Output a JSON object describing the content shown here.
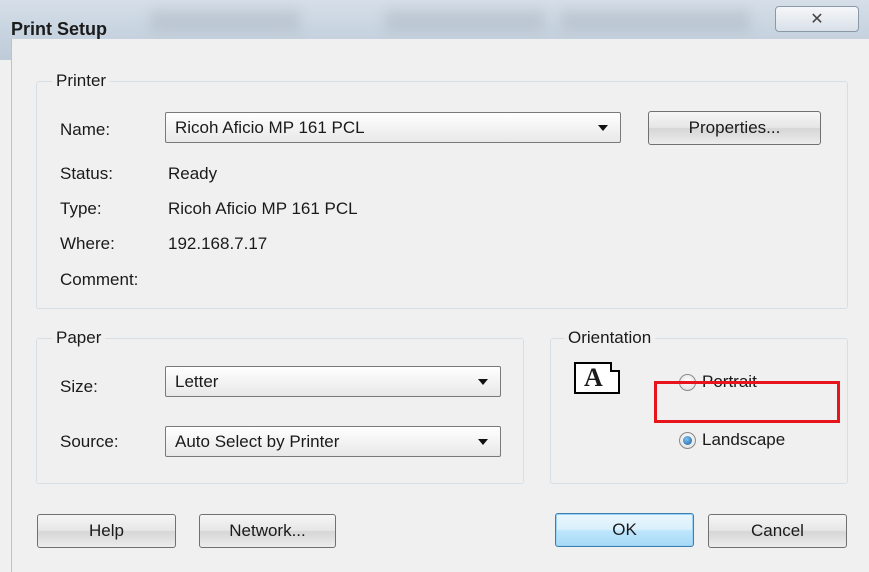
{
  "window": {
    "title": "Print Setup",
    "close_glyph": "✕"
  },
  "printer": {
    "legend": "Printer",
    "name_label": "Name:",
    "name_value": "Ricoh Aficio MP 161 PCL",
    "properties_label": "Properties...",
    "status_label": "Status:",
    "status_value": "Ready",
    "type_label": "Type:",
    "type_value": "Ricoh Aficio MP 161 PCL",
    "where_label": "Where:",
    "where_value": "192.168.7.17",
    "comment_label": "Comment:",
    "comment_value": ""
  },
  "paper": {
    "legend": "Paper",
    "size_label": "Size:",
    "size_value": "Letter",
    "source_label": "Source:",
    "source_value": "Auto Select by Printer"
  },
  "orientation": {
    "legend": "Orientation",
    "icon_letter": "A",
    "portrait_label": "Portrait",
    "landscape_label": "Landscape",
    "selected": "Landscape",
    "highlight_color": "#e8141c"
  },
  "footer": {
    "help_label": "Help",
    "network_label": "Network...",
    "ok_label": "OK",
    "cancel_label": "Cancel"
  }
}
